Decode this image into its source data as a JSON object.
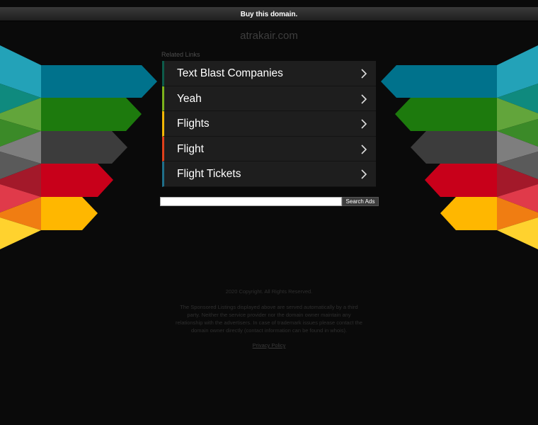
{
  "topbar": {
    "buy_label": "Buy this domain."
  },
  "domain_name": "atrakair.com",
  "related_label": "Related Links",
  "links": [
    {
      "label": "Text Blast Companies",
      "accent": "#0d5b4a"
    },
    {
      "label": "Yeah",
      "accent": "#7cb31c"
    },
    {
      "label": "Flights",
      "accent": "#f2b705"
    },
    {
      "label": "Flight",
      "accent": "#e0401b"
    },
    {
      "label": "Flight Tickets",
      "accent": "#1f6f8a"
    }
  ],
  "search": {
    "button_label": "Search Ads",
    "placeholder": ""
  },
  "footer": {
    "copyright": "2020 Copyright. All Rights Reserved.",
    "disclaimer": "The Sponsored Listings displayed above are served automatically by a third party. Neither the service provider nor the domain owner maintain any relationship with the advertisers. In case of trademark issues please contact the domain owner directly (contact information can be found in whois).",
    "privacy_label": "Privacy Policy"
  },
  "colors": {
    "teal": "#00728c",
    "green": "#1a7a0c",
    "gray": "#3c3c3c",
    "red": "#c8001a",
    "yellow": "#ffb700"
  }
}
